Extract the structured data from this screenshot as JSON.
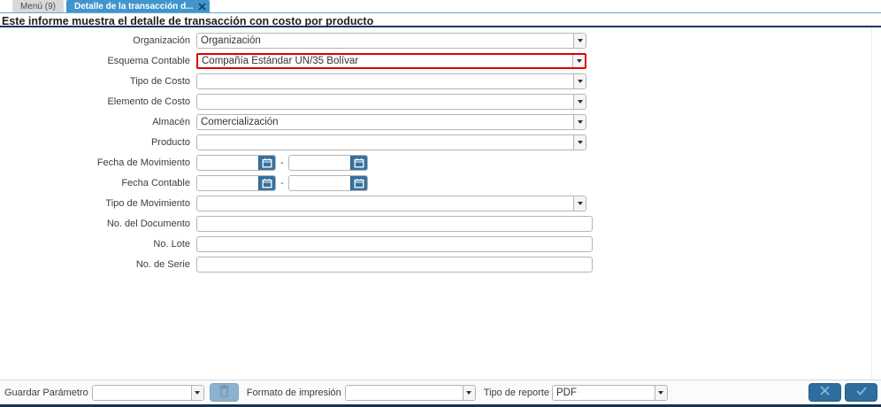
{
  "tabs": {
    "menu": {
      "label": "Menú (9)"
    },
    "active": {
      "label": "Detalle de la transacción d..."
    }
  },
  "header": {
    "description": "Este informe muestra el detalle de transacción con costo por producto"
  },
  "form": {
    "fields": [
      {
        "label": "Organización",
        "type": "combobox",
        "value": "Organización"
      },
      {
        "label": "Esquema Contable",
        "type": "combobox",
        "value": "Compañía Estándar UN/35 Bolívar",
        "highlighted": true
      },
      {
        "label": "Tipo de Costo",
        "type": "combobox",
        "value": ""
      },
      {
        "label": "Elemento de Costo",
        "type": "combobox",
        "value": ""
      },
      {
        "label": "Almacén",
        "type": "combobox",
        "value": "Comercialización"
      },
      {
        "label": "Producto",
        "type": "combobox",
        "value": ""
      },
      {
        "label": "Fecha de Movimiento",
        "type": "daterange",
        "value_from": "",
        "value_to": "",
        "separator": "-"
      },
      {
        "label": "Fecha Contable",
        "type": "daterange",
        "value_from": "",
        "value_to": "",
        "separator": "-"
      },
      {
        "label": "Tipo de Movimiento",
        "type": "combobox",
        "value": ""
      },
      {
        "label": "No. del Documento",
        "type": "text",
        "value": ""
      },
      {
        "label": "No. Lote",
        "type": "text",
        "value": ""
      },
      {
        "label": "No. de Serie",
        "type": "text",
        "value": ""
      }
    ]
  },
  "footer": {
    "save_parameter_label": "Guardar Parámetro",
    "save_parameter_value": "",
    "print_format_label": "Formato de impresión",
    "print_format_value": "",
    "report_type_label": "Tipo de reporte",
    "report_type_value": "PDF"
  },
  "icons": {
    "tab_close": "close-icon",
    "combo_arrow": "chevron-down-icon",
    "calendar": "calendar-icon",
    "trash": "trash-icon",
    "cancel": "x-icon",
    "confirm": "check-icon"
  },
  "colors": {
    "active_tab": "#4195cc",
    "title_underline": "#16365c",
    "highlight_border": "#e00000",
    "calendar_button": "#36719f",
    "action_button": "#2e6e9e",
    "trash_button": "#8db1ce"
  }
}
